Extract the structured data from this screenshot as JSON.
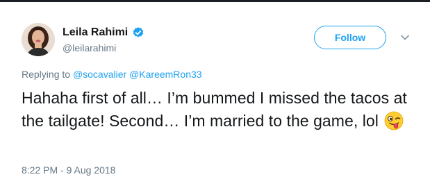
{
  "author": {
    "display_name": "Leila Rahimi",
    "handle": "@leilarahimi",
    "verified": true,
    "avatar_icon": "profile-photo-icon"
  },
  "actions": {
    "follow_label": "Follow",
    "menu_icon": "chevron-down-icon"
  },
  "reply": {
    "prefix": "Replying to",
    "mentions": [
      "@socavalier",
      "@KareemRon33"
    ]
  },
  "tweet": {
    "text": "Hahaha first of all… I’m bummed I missed the tacos at the tailgate! Second… I’m married to the game, lol",
    "emoji": "winking-face-with-tongue-icon"
  },
  "timestamp": "8:22 PM - 9 Aug 2018",
  "colors": {
    "accent": "#1da1f2",
    "secondary_text": "#657786",
    "primary_text": "#14171a"
  }
}
